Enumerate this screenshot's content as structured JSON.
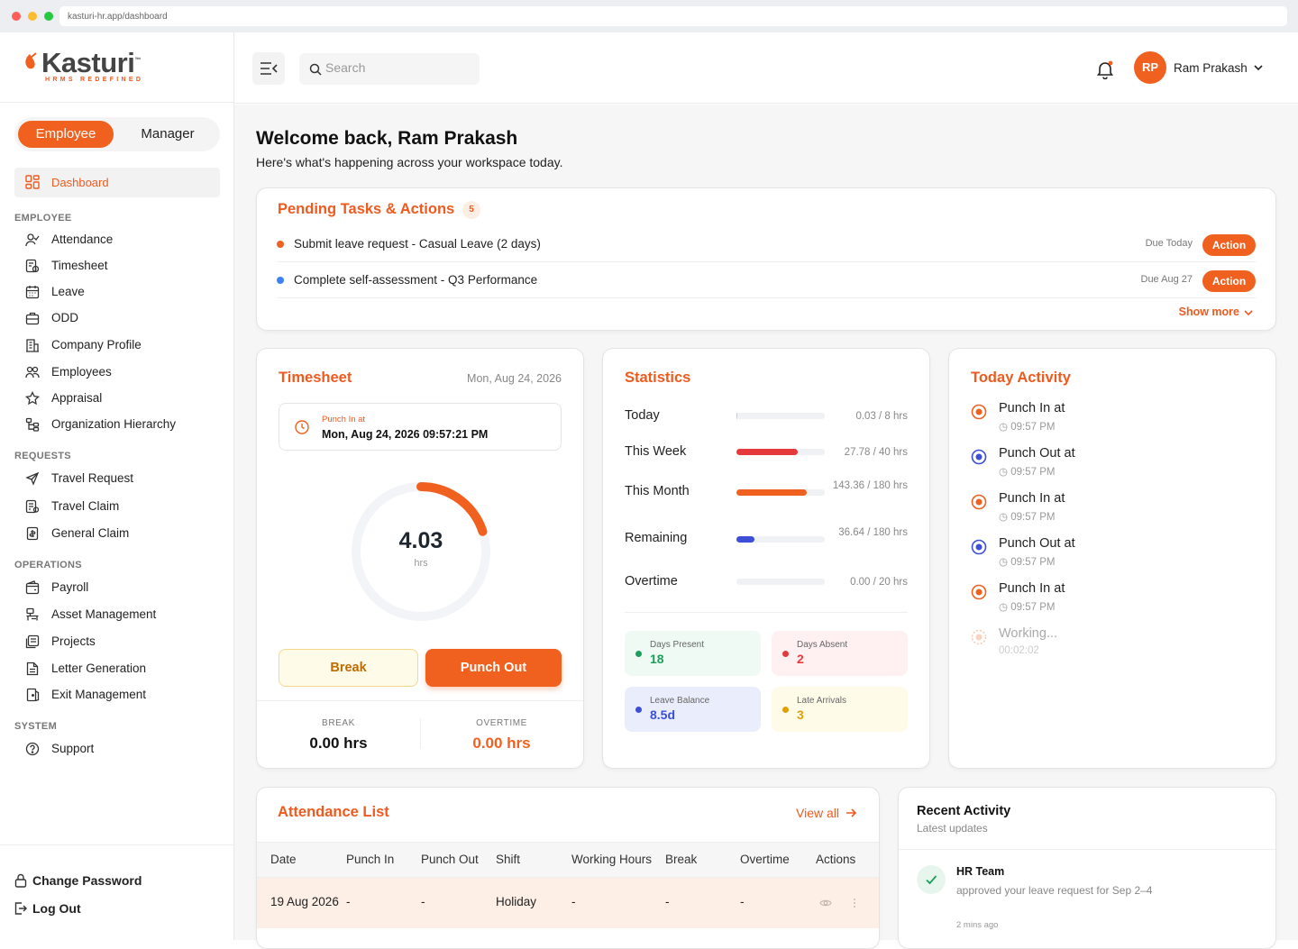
{
  "browser": {
    "url": "kasturi-hr.app/dashboard"
  },
  "brand": {
    "name": "Kasturi",
    "tm": "™",
    "tagline": "HRMS REDEFINED",
    "accent": "#f0601f"
  },
  "role_toggle": {
    "employee": "Employee",
    "manager": "Manager",
    "active": "Employee"
  },
  "sidebar": {
    "active": {
      "label": "Dashboard",
      "icon": "grid-icon"
    },
    "sections": {
      "employee": "EMPLOYEE",
      "requests": "REQUESTS",
      "operations": "OPERATIONS",
      "system": "SYSTEM"
    },
    "employee_items": [
      {
        "label": "Attendance",
        "icon": "user-check-icon"
      },
      {
        "label": "Timesheet",
        "icon": "timesheet-icon"
      },
      {
        "label": "Leave",
        "icon": "calendar-icon"
      },
      {
        "label": "ODD",
        "icon": "briefcase-icon"
      },
      {
        "label": "Company Profile",
        "icon": "building-icon"
      },
      {
        "label": "Employees",
        "icon": "users-icon"
      },
      {
        "label": "Appraisal",
        "icon": "star-icon"
      },
      {
        "label": "Organization Hierarchy",
        "icon": "hierarchy-icon"
      }
    ],
    "request_items": [
      {
        "label": "Travel Request",
        "icon": "plane-icon"
      },
      {
        "label": "Travel Claim",
        "icon": "receipt-icon"
      },
      {
        "label": "General Claim",
        "icon": "claim-icon"
      }
    ],
    "operation_items": [
      {
        "label": "Payroll",
        "icon": "wallet-icon"
      },
      {
        "label": "Asset Management",
        "icon": "asset-icon"
      },
      {
        "label": "Projects",
        "icon": "projects-icon"
      },
      {
        "label": "Letter Generation",
        "icon": "letter-icon"
      },
      {
        "label": "Exit Management",
        "icon": "exit-icon"
      }
    ],
    "system_items": [
      {
        "label": "Support",
        "icon": "help-icon"
      }
    ],
    "bottom": {
      "change_password": "Change Password",
      "logout": "Log Out"
    }
  },
  "header": {
    "search_placeholder": "Search",
    "user_initials": "RP",
    "user_name": "Ram Prakash"
  },
  "welcome": {
    "title": "Welcome back, Ram Prakash",
    "subtitle": "Here's what's happening across your workspace today."
  },
  "pending": {
    "title": "Pending Tasks & Actions",
    "count": "5",
    "tasks": [
      {
        "text": "Submit leave request - Casual Leave (2 days)",
        "due": "Due Today",
        "action": "Action",
        "color": "#f0601f"
      },
      {
        "text": "Complete self-assessment - Q3 Performance",
        "due": "Due Aug 27",
        "action": "Action",
        "color": "#3b82f6"
      }
    ],
    "show_more": "Show more"
  },
  "timesheet": {
    "title": "Timesheet",
    "date": "Mon, Aug 24, 2026",
    "punch_label": "Punch In at",
    "punch_value": "Mon, Aug 24, 2026 09:57:21 PM",
    "hours": "4.03",
    "hours_unit": "hrs",
    "progress": 0.2,
    "break_btn": "Break",
    "punch_btn": "Punch Out",
    "break_label": "BREAK",
    "break_value": "0.00 hrs",
    "overtime_label": "OVERTIME",
    "overtime_value": "0.00 hrs"
  },
  "statistics": {
    "title": "Statistics",
    "rows": [
      {
        "label": "Today",
        "value": "0.03 / 8 hrs",
        "fraction": 0.004,
        "color": "#c9ccd3"
      },
      {
        "label": "This Week",
        "value": "27.78 / 40 hrs",
        "fraction": 0.69,
        "color": "#e5393b"
      },
      {
        "label": "This Month",
        "value": "143.36 / 180 hrs",
        "fraction": 0.8,
        "color": "#f0601f"
      },
      {
        "label": "Remaining",
        "value": "36.64 / 180 hrs",
        "fraction": 0.2,
        "color": "#3b4fd8"
      },
      {
        "label": "Overtime",
        "value": "0.00 / 20 hrs",
        "fraction": 0,
        "color": "#c9ccd3"
      }
    ],
    "tiles": [
      {
        "label": "Days Present",
        "value": "18",
        "bg": "#eefaf3",
        "color": "#1e9e5a"
      },
      {
        "label": "Days Absent",
        "value": "2",
        "bg": "#fff1f1",
        "color": "#e5393b"
      },
      {
        "label": "Leave Balance",
        "value": "8.5d",
        "bg": "#eaeefc",
        "color": "#3b4fd8"
      },
      {
        "label": "Late Arrivals",
        "value": "3",
        "bg": "#fffbe9",
        "color": "#e2a000"
      }
    ]
  },
  "today_activity": {
    "title": "Today Activity",
    "items": [
      {
        "label": "Punch In at",
        "time": "09:57 PM",
        "kind": "in"
      },
      {
        "label": "Punch Out at",
        "time": "09:57 PM",
        "kind": "out"
      },
      {
        "label": "Punch In at",
        "time": "09:57 PM",
        "kind": "in"
      },
      {
        "label": "Punch Out at",
        "time": "09:57 PM",
        "kind": "out"
      },
      {
        "label": "Punch In at",
        "time": "09:57 PM",
        "kind": "in"
      },
      {
        "label": "Working...",
        "time": "00:02:02",
        "kind": "working"
      }
    ]
  },
  "attendance": {
    "title": "Attendance List",
    "view_all": "View all",
    "columns": [
      "Date",
      "Punch In",
      "Punch Out",
      "Shift",
      "Working Hours",
      "Break",
      "Overtime",
      "Actions"
    ],
    "rows": [
      {
        "date": "19 Aug 2026",
        "punch_in": "-",
        "punch_out": "-",
        "shift": "Holiday",
        "working": "-",
        "break": "-",
        "overtime": "-"
      }
    ]
  },
  "recent": {
    "title": "Recent Activity",
    "subtitle": "Latest updates",
    "items": [
      {
        "who": "HR Team",
        "text": "approved your leave request for Sep 2–4",
        "time": "2 mins ago"
      }
    ]
  }
}
